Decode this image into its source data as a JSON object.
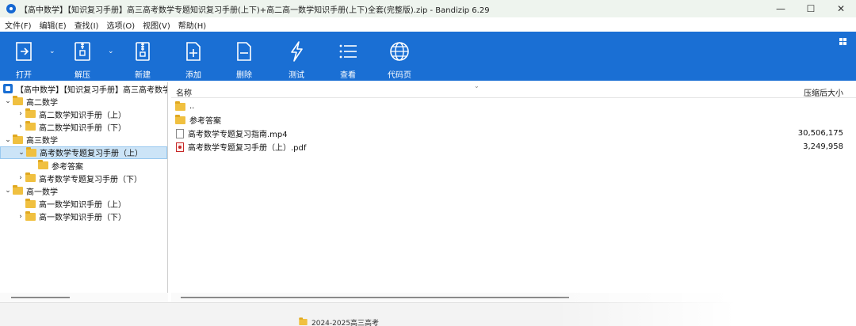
{
  "window": {
    "title": "【高中数学】【知识复习手册】高三高考数学专题知识复习手册(上下)+高二高一数学知识手册(上下)全套(完整版).zip - Bandizip 6.29",
    "minimize": "—",
    "maximize": "☐",
    "close": "✕"
  },
  "menu": [
    "文件(F)",
    "编辑(E)",
    "查找(I)",
    "选项(O)",
    "视图(V)",
    "帮助(H)"
  ],
  "toolbar": {
    "open": "打开",
    "extract": "解压",
    "new": "新建",
    "add": "添加",
    "delete": "删除",
    "test": "测试",
    "view": "查看",
    "codepage": "代码页"
  },
  "tree": {
    "root": "【高中数学】【知识复习手册】高三高考数学专题知识复习手册(上下)+高二高一数学知识手册(上下)全套(完整版).zip",
    "nodes": [
      {
        "label": "高二数学",
        "level": 0,
        "expanded": true
      },
      {
        "label": "高二数学知识手册（上）",
        "level": 1,
        "expanded": false
      },
      {
        "label": "高二数学知识手册（下）",
        "level": 1,
        "expanded": false
      },
      {
        "label": "高三数学",
        "level": 0,
        "expanded": true
      },
      {
        "label": "高考数学专题复习手册（上）",
        "level": 1,
        "expanded": true,
        "selected": true
      },
      {
        "label": "参考答案",
        "level": 2,
        "expanded": null
      },
      {
        "label": "高考数学专题复习手册（下）",
        "level": 1,
        "expanded": false
      },
      {
        "label": "高一数学",
        "level": 0,
        "expanded": true
      },
      {
        "label": "高一数学知识手册（上）",
        "level": 1,
        "expanded": null
      },
      {
        "label": "高一数学知识手册（下）",
        "level": 1,
        "expanded": false
      }
    ]
  },
  "list": {
    "col_name": "名称",
    "col_size": "压缩后大小",
    "rows": [
      {
        "name": "..",
        "size": "",
        "kind": "folder"
      },
      {
        "name": "参考答案",
        "size": "",
        "kind": "folder"
      },
      {
        "name": "高考数学专题复习指南.mp4",
        "size": "30,506,175",
        "kind": "file"
      },
      {
        "name": "高考数学专题复习手册（上）.pdf",
        "size": "3,249,958",
        "kind": "pdf"
      }
    ]
  },
  "background_peek": "2024-2025高三高考",
  "colors": {
    "toolbar": "#1a6fd4",
    "titlebar": "#eef4ee",
    "selection": "#cce4f7",
    "folder": "#f0c040"
  }
}
